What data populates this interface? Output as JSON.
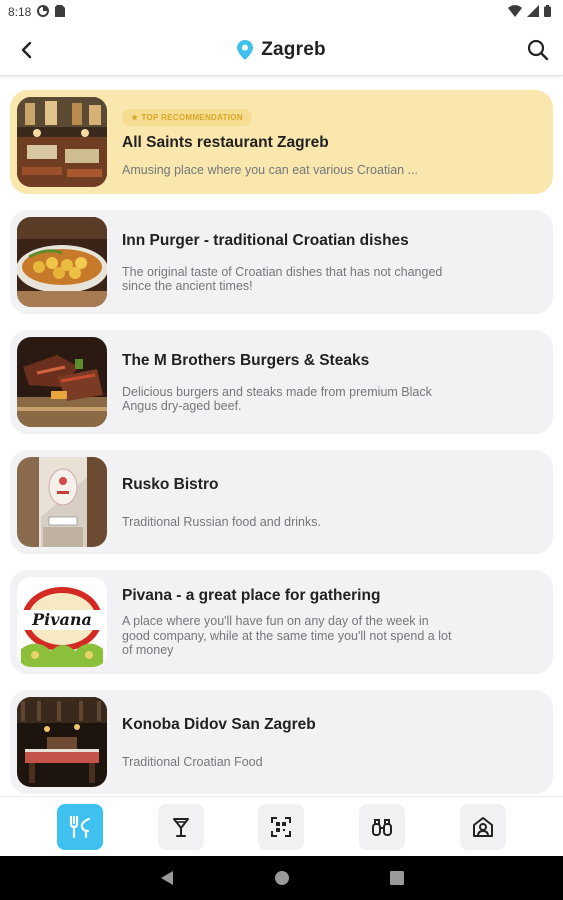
{
  "status_bar": {
    "time": "8:18"
  },
  "header": {
    "title": "Zagreb",
    "accent_color": "#3ec1ef"
  },
  "restaurants": [
    {
      "badge": "TOP RECOMMENDATION",
      "name": "All Saints restaurant Zagreb",
      "description": "Amusing place where you can eat various Croatian ...",
      "featured": true
    },
    {
      "name": "Inn Purger - traditional Croatian dishes",
      "description": "The original taste of Croatian dishes that has not changed since the ancient times!"
    },
    {
      "name": "The M Brothers Burgers & Steaks",
      "description": "Delicious burgers and steaks made from premium Black Angus dry-aged beef."
    },
    {
      "name": "Rusko Bistro",
      "description": "Traditional Russian food and drinks."
    },
    {
      "name": "Pivana - a great place for gathering",
      "description": "A place where you'll have fun on any day of the week in good company, while at the same time you'll not spend a lot of money",
      "logo_text": "Pivana"
    },
    {
      "name": "Konoba Didov San Zagreb",
      "description": "Traditional Croatian Food"
    }
  ],
  "bottom_nav": [
    {
      "icon": "restaurant-icon",
      "active": true
    },
    {
      "icon": "cocktail-icon",
      "active": false
    },
    {
      "icon": "qr-scan-icon",
      "active": false
    },
    {
      "icon": "binoculars-icon",
      "active": false
    },
    {
      "icon": "home-person-icon",
      "active": false
    }
  ],
  "colors": {
    "featured_card": "#f9e7ad",
    "card": "#f2f2f4",
    "badge_text": "#d8a726"
  }
}
